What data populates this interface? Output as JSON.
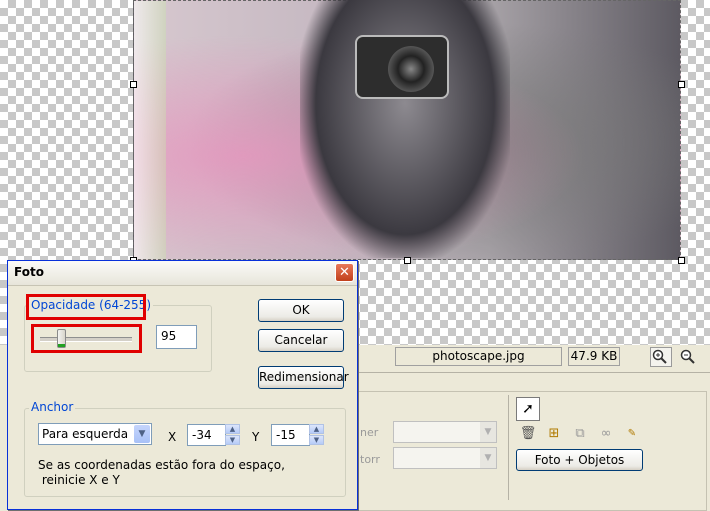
{
  "editor": {
    "status": {
      "filename": "photoscape.jpg",
      "filesize": "47.9 KB"
    },
    "panel": {
      "faded_label_1": "ner",
      "faded_label_2": "torr",
      "photo_objects_button": "Foto + Objetos"
    }
  },
  "dialog": {
    "title": "Foto",
    "close_glyph": "✕",
    "opacity": {
      "legend": "Opacidade (64-255)",
      "value": "95",
      "range_min": 64,
      "range_max": 255
    },
    "buttons": {
      "ok": "OK",
      "cancel": "Cancelar",
      "resize": "Redimensionar"
    },
    "anchor": {
      "legend": "Anchor",
      "position": "Para esquerda",
      "x_label": "X",
      "x_value": "-34",
      "y_label": "Y",
      "y_value": "-15",
      "note": "Se as coordenadas estão fora do espaço,\n reinicie X e Y"
    }
  },
  "icons": [
    "zoom-in-icon",
    "zoom-out-icon",
    "pointer-icon",
    "trash-icon",
    "add-object-icon",
    "copy-icon",
    "link-icon",
    "text-icon"
  ]
}
